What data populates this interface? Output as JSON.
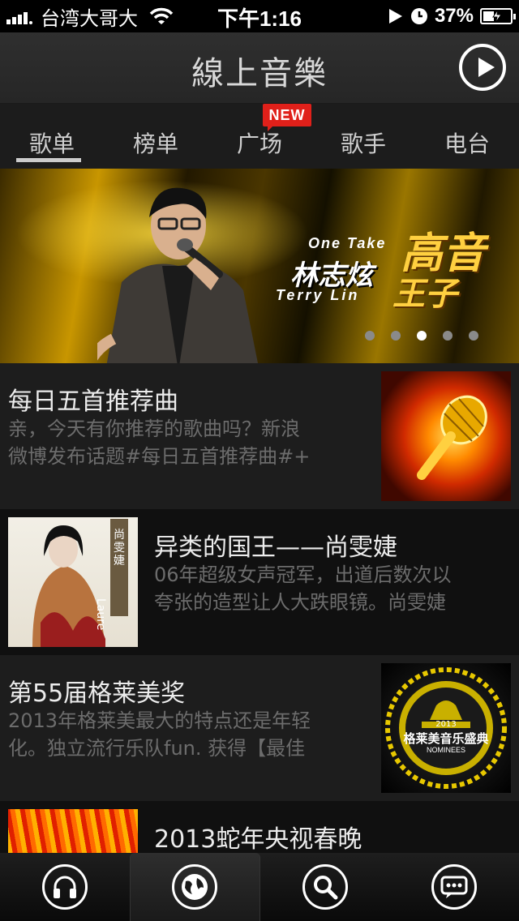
{
  "status_bar": {
    "carrier": "台湾大哥大",
    "time": "下午1:16",
    "battery": "37%"
  },
  "header": {
    "title": "線上音樂",
    "play_icon": "play-circle-icon"
  },
  "tabs": [
    {
      "label": "歌单",
      "active": true
    },
    {
      "label": "榜单",
      "active": false
    },
    {
      "label": "广场",
      "active": false
    },
    {
      "label": "歌手",
      "active": false
    },
    {
      "label": "电台",
      "active": false
    }
  ],
  "new_badge": "NEW",
  "banner": {
    "onetake": "One Take",
    "name_cn": "林志炫",
    "name_en": "Terry Lin",
    "big_line1": "高音",
    "big_line2": "王子",
    "page_count": 5,
    "active_page": 3
  },
  "list": [
    {
      "title": "每日五首推荐曲",
      "desc_line1": "亲，今天有你推荐的歌曲吗？新浪",
      "desc_line2": "微博发布话题#每日五首推荐曲#+"
    },
    {
      "title": "异类的国王——尚雯婕",
      "desc_line1": "06年超级女声冠军，出道后数次以",
      "desc_line2": "夸张的造型让人大跌眼镜。尚雯婕",
      "thumb_text_cn": "尚雯婕",
      "thumb_text_en": "Laure"
    },
    {
      "title": "第55届格莱美奖",
      "desc_line1": "2013年格莱美最大的特点还是年轻",
      "desc_line2": "化。独立流行乐队fun. 获得【最佳",
      "thumb_year": "2013",
      "thumb_text_cn": "格莱美音乐盛典",
      "thumb_text_en": "NOMINEES"
    },
    {
      "title": "2013蛇年央视春晚"
    }
  ],
  "tabbar": [
    {
      "icon": "headphones-icon",
      "active": false
    },
    {
      "icon": "globe-icon",
      "active": true
    },
    {
      "icon": "search-icon",
      "active": false
    },
    {
      "icon": "chat-icon",
      "active": false
    }
  ]
}
